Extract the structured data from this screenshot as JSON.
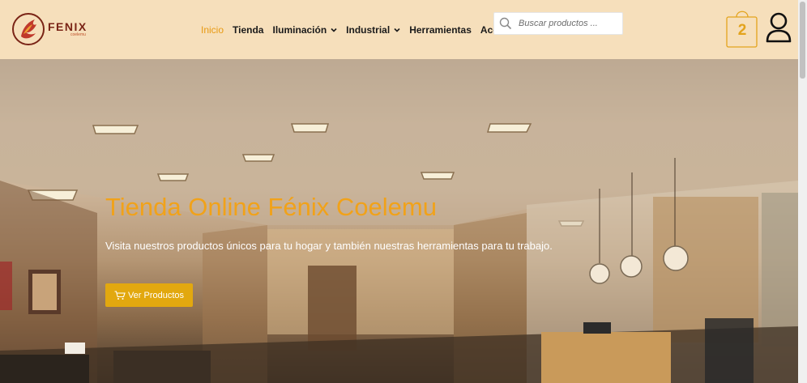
{
  "brand": {
    "name": "FENIX",
    "tagline": "coelemu"
  },
  "nav": {
    "items": [
      {
        "label": "Inicio",
        "active": true,
        "dropdown": false
      },
      {
        "label": "Tienda",
        "active": false,
        "dropdown": false
      },
      {
        "label": "Iluminación",
        "active": false,
        "dropdown": true
      },
      {
        "label": "Industrial",
        "active": false,
        "dropdown": true
      },
      {
        "label": "Herramientas",
        "active": false,
        "dropdown": false
      },
      {
        "label": "Accesorios",
        "active": false,
        "dropdown": false
      }
    ]
  },
  "search": {
    "placeholder": "Buscar productos ...",
    "value": ""
  },
  "cart": {
    "count": "2"
  },
  "hero": {
    "title": "Tienda Online Fénix Coelemu",
    "subtitle": "Visita nuestros productos únicos para tu hogar y también nuestras herramientas para tu trabajo.",
    "button_label": "Ver Productos"
  },
  "colors": {
    "header_bg": "#f6dfbb",
    "accent": "#e89a13",
    "button": "#e2a80f",
    "title": "#f1a219"
  },
  "icons": {
    "search": "search-icon",
    "cart": "shopping-bag-icon",
    "user": "user-icon",
    "button": "cart-icon",
    "dropdown": "chevron-down-icon"
  }
}
